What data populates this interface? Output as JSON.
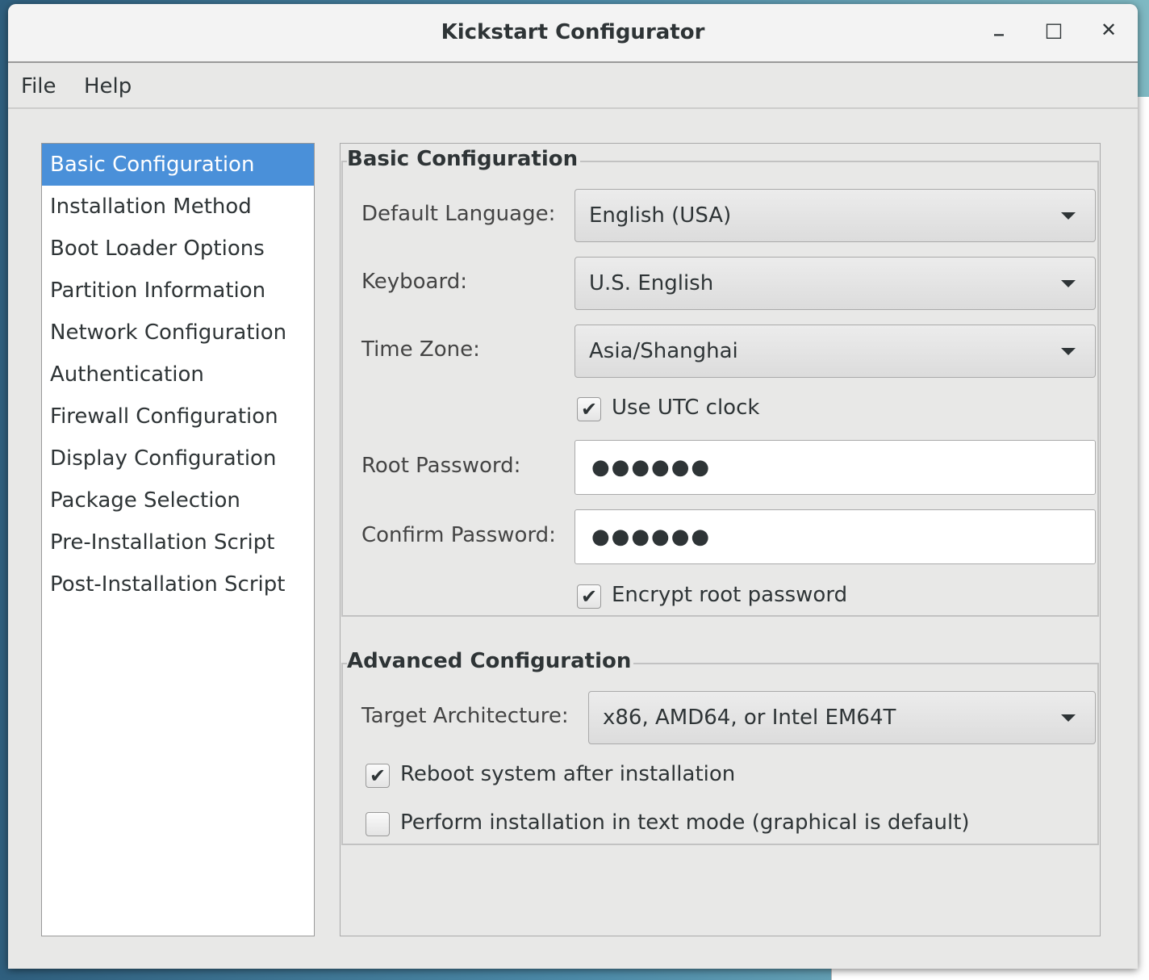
{
  "window": {
    "title": "Kickstart Configurator",
    "minimize_icon": "_",
    "maximize_icon": "□",
    "close_icon": "✕"
  },
  "menu": [
    "File",
    "Help"
  ],
  "sidebar": {
    "items": [
      "Basic Configuration",
      "Installation Method",
      "Boot Loader Options",
      "Partition Information",
      "Network Configuration",
      "Authentication",
      "Firewall Configuration",
      "Display Configuration",
      "Package Selection",
      "Pre-Installation Script",
      "Post-Installation Script"
    ],
    "selected": "Basic Configuration"
  },
  "basic": {
    "title": "Basic Configuration",
    "language_label": "Default Language:",
    "language_value": "English (USA)",
    "keyboard_label": "Keyboard:",
    "keyboard_value": "U.S. English",
    "timezone_label": "Time Zone:",
    "timezone_value": "Asia/Shanghai",
    "utc_label": "Use UTC clock",
    "utc_checked": true,
    "root_password_label": "Root Password:",
    "root_password_value": "●●●●●●",
    "confirm_password_label": "Confirm Password:",
    "confirm_password_value": "●●●●●●",
    "encrypt_label": "Encrypt root password",
    "encrypt_checked": true
  },
  "advanced": {
    "title": "Advanced Configuration",
    "arch_label": "Target Architecture:",
    "arch_value": "x86, AMD64, or Intel EM64T",
    "reboot_label": "Reboot system after installation",
    "reboot_checked": true,
    "textmode_label": "Perform installation in text mode (graphical is default)",
    "textmode_checked": false
  },
  "check_glyph": "✔",
  "colors": {
    "selection": "#4a90d9"
  }
}
